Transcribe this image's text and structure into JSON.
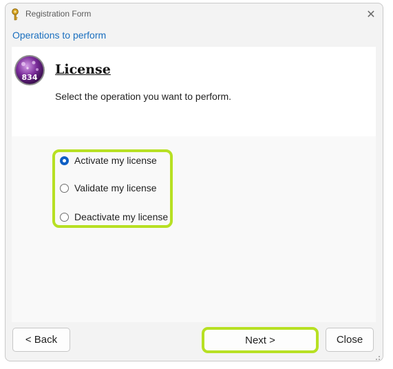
{
  "window": {
    "title": "Registration Form"
  },
  "section": {
    "label": "Operations to perform"
  },
  "header": {
    "title": "License",
    "subtitle": "Select the operation you want to perform.",
    "logo_text": "834"
  },
  "options": [
    {
      "label": "Activate my license",
      "selected": true
    },
    {
      "label": "Validate my license",
      "selected": false
    },
    {
      "label": "Deactivate my license",
      "selected": false
    }
  ],
  "buttons": {
    "back": "< Back",
    "next": "Next >",
    "close": "Close"
  },
  "colors": {
    "highlight": "#b7e023",
    "accent": "#0f5fc4",
    "link": "#1a6fbf"
  },
  "icons": {
    "title": "key-icon",
    "close": "close-icon",
    "logo": "app-logo-icon"
  }
}
